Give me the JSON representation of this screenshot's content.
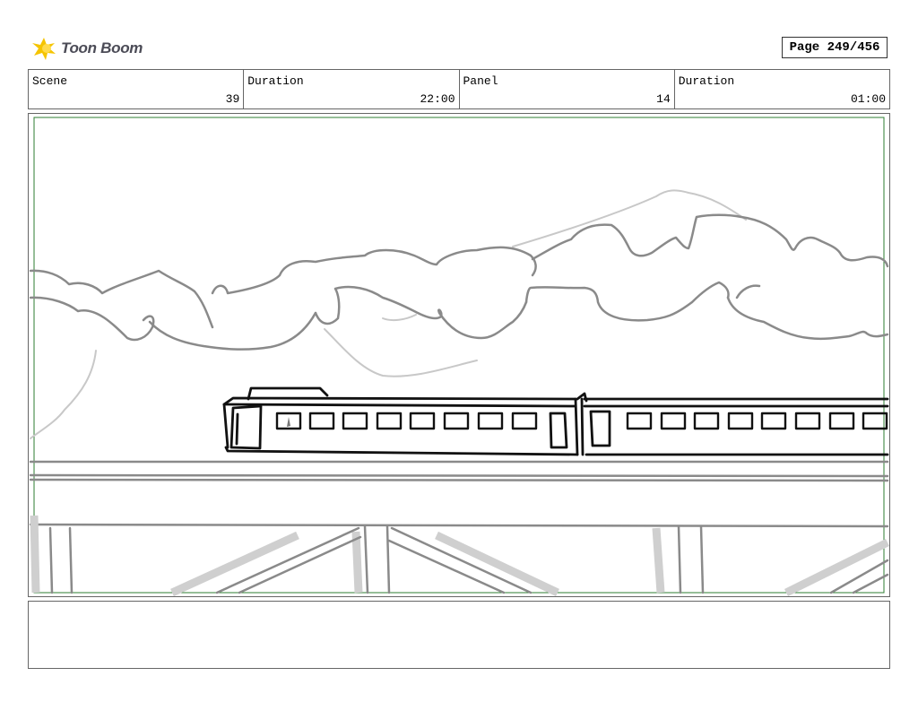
{
  "header": {
    "logo_text": "Toon Boom",
    "page_label": "Page 249/456"
  },
  "info": {
    "scene_label": "Scene",
    "scene_value": "39",
    "scene_duration_label": "Duration",
    "scene_duration_value": "22:00",
    "panel_label": "Panel",
    "panel_value": "14",
    "panel_duration_label": "Duration",
    "panel_duration_value": "01:00"
  },
  "notes": {
    "text": ""
  },
  "colors": {
    "logo_accent": "#f5c400",
    "safe_frame": "#2e7d32",
    "sketch_dark": "#111111",
    "sketch_grey": "#8a8a8a",
    "sketch_light": "#c8c8c8"
  }
}
